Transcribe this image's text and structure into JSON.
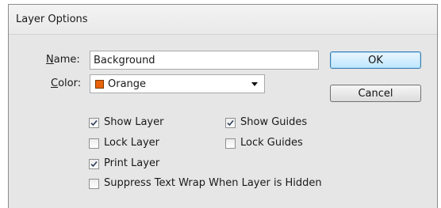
{
  "dialog": {
    "title": "Layer Options",
    "name_label_mnemonic": "N",
    "name_label_rest": "ame:",
    "name_value": "Background",
    "color_label_mnemonic": "C",
    "color_label_rest": "olor:",
    "color_value": "Orange",
    "color_swatch": "#e8630a",
    "ok_label": "OK",
    "cancel_label": "Cancel"
  },
  "options": {
    "show_layer": {
      "label": "Show Layer",
      "checked": true
    },
    "show_guides": {
      "label": "Show Guides",
      "checked": true
    },
    "lock_layer": {
      "label": "Lock Layer",
      "checked": false
    },
    "lock_guides": {
      "label": "Lock Guides",
      "checked": false
    },
    "print_layer": {
      "label": "Print Layer",
      "checked": true
    },
    "suppress_text_wrap": {
      "label": "Suppress Text Wrap When Layer is Hidden",
      "checked": false
    }
  }
}
